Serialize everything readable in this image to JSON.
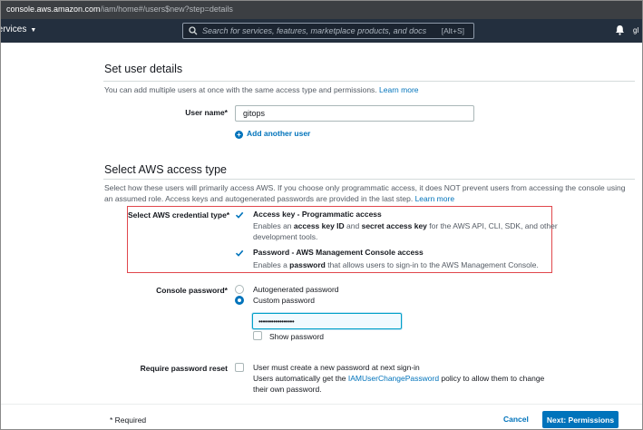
{
  "browser": {
    "url_domain": "console.aws.amazon.com",
    "url_path": "/iam/home#/users$new?step=details"
  },
  "topnav": {
    "services_label": "Services",
    "search_placeholder": "Search for services, features, marketplace products, and docs",
    "search_shortcut": "[Alt+S]",
    "account_fragment": "gl"
  },
  "set_user_details": {
    "title": "Set user details",
    "description": "You can add multiple users at once with the same access type and permissions.",
    "learn_more": "Learn more",
    "user_name_label": "User name*",
    "user_name_value": "gitops",
    "add_another_user": "Add another user"
  },
  "access_type": {
    "title": "Select AWS access type",
    "description_line1": "Select how these users will primarily access AWS. If you choose only programmatic access, it does NOT prevent users from accessing the console using",
    "description_line2": "an assumed role. Access keys and autogenerated passwords are provided in the last step.",
    "learn_more": "Learn more",
    "credential_type_label": "Select AWS credential type*",
    "options": [
      {
        "title": "Access key - Programmatic access",
        "desc_pre": "Enables an ",
        "desc_b1": "access key ID",
        "desc_mid": " and ",
        "desc_b2": "secret access key",
        "desc_post": " for the AWS API, CLI, SDK, and other",
        "desc_line2": "development tools.",
        "checked": true
      },
      {
        "title": "Password - AWS Management Console access",
        "desc_pre": "Enables a ",
        "desc_b1": "password",
        "desc_post": " that allows users to sign-in to the AWS Management Console.",
        "checked": true
      }
    ]
  },
  "console_password": {
    "label": "Console password*",
    "autogenerated_label": "Autogenerated password",
    "custom_label": "Custom password",
    "selected": "Custom password",
    "password_mask": "•••••••••••••••••",
    "show_password_label": "Show password"
  },
  "password_reset": {
    "label": "Require password reset",
    "line1": "User must create a new password at next sign-in",
    "line2_pre": "Users automatically get the ",
    "line2_link": "IAMUserChangePassword",
    "line2_post": " policy to allow them to change",
    "line3": "their own password.",
    "checked": false
  },
  "footer": {
    "required_note": "* Required",
    "cancel_label": "Cancel",
    "next_label": "Next: Permissions"
  },
  "colors": {
    "aws_nav": "#232f3e",
    "link_blue": "#0073bb",
    "highlight_red": "#e0474c"
  }
}
